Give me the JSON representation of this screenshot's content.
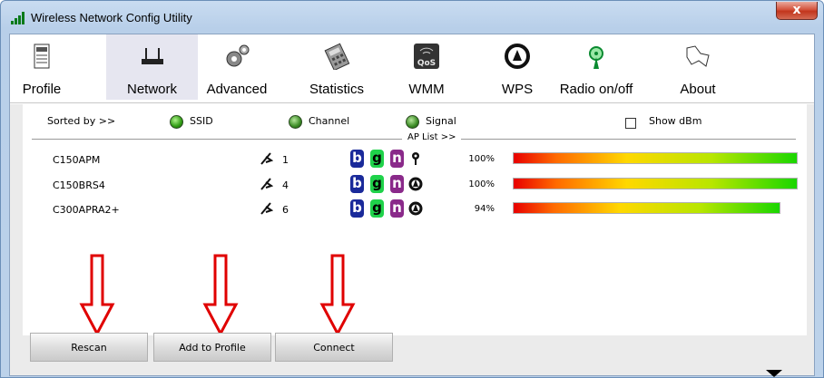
{
  "window": {
    "title": "Wireless Network Config Utility",
    "close_label": "x"
  },
  "toolbar": {
    "items": [
      {
        "label": "Profile",
        "icon": "profile-icon"
      },
      {
        "label": "Network",
        "icon": "router-icon",
        "selected": true
      },
      {
        "label": "Advanced",
        "icon": "gears-icon"
      },
      {
        "label": "Statistics",
        "icon": "calculator-icon"
      },
      {
        "label": "WMM",
        "icon": "qos-icon"
      },
      {
        "label": "WPS",
        "icon": "wps-icon"
      },
      {
        "label": "Radio on/off",
        "icon": "antenna-icon"
      },
      {
        "label": "About",
        "icon": "about-icon"
      }
    ]
  },
  "sort": {
    "label": "Sorted by >>",
    "options": [
      "SSID",
      "Channel",
      "Signal"
    ],
    "show_dbm": "Show dBm"
  },
  "ap_list": {
    "title": "AP List >>",
    "rows": [
      {
        "ssid": "C150APM",
        "channel": "1",
        "security": "key-icon",
        "signal_text": "100%",
        "signal": 100
      },
      {
        "ssid": "C150BRS4",
        "channel": "4",
        "security": "wps-icon",
        "signal_text": "100%",
        "signal": 100
      },
      {
        "ssid": "C300APRA2+",
        "channel": "6",
        "security": "wps-icon",
        "signal_text": "94%",
        "signal": 94
      }
    ],
    "modes": [
      "b",
      "g",
      "n"
    ]
  },
  "buttons": {
    "rescan": "Rescan",
    "add_to_profile": "Add to Profile",
    "connect": "Connect"
  },
  "colors": {
    "annotation_arrow": "#e00000",
    "signal_low": "#e80000",
    "signal_high": "#1ad600"
  }
}
